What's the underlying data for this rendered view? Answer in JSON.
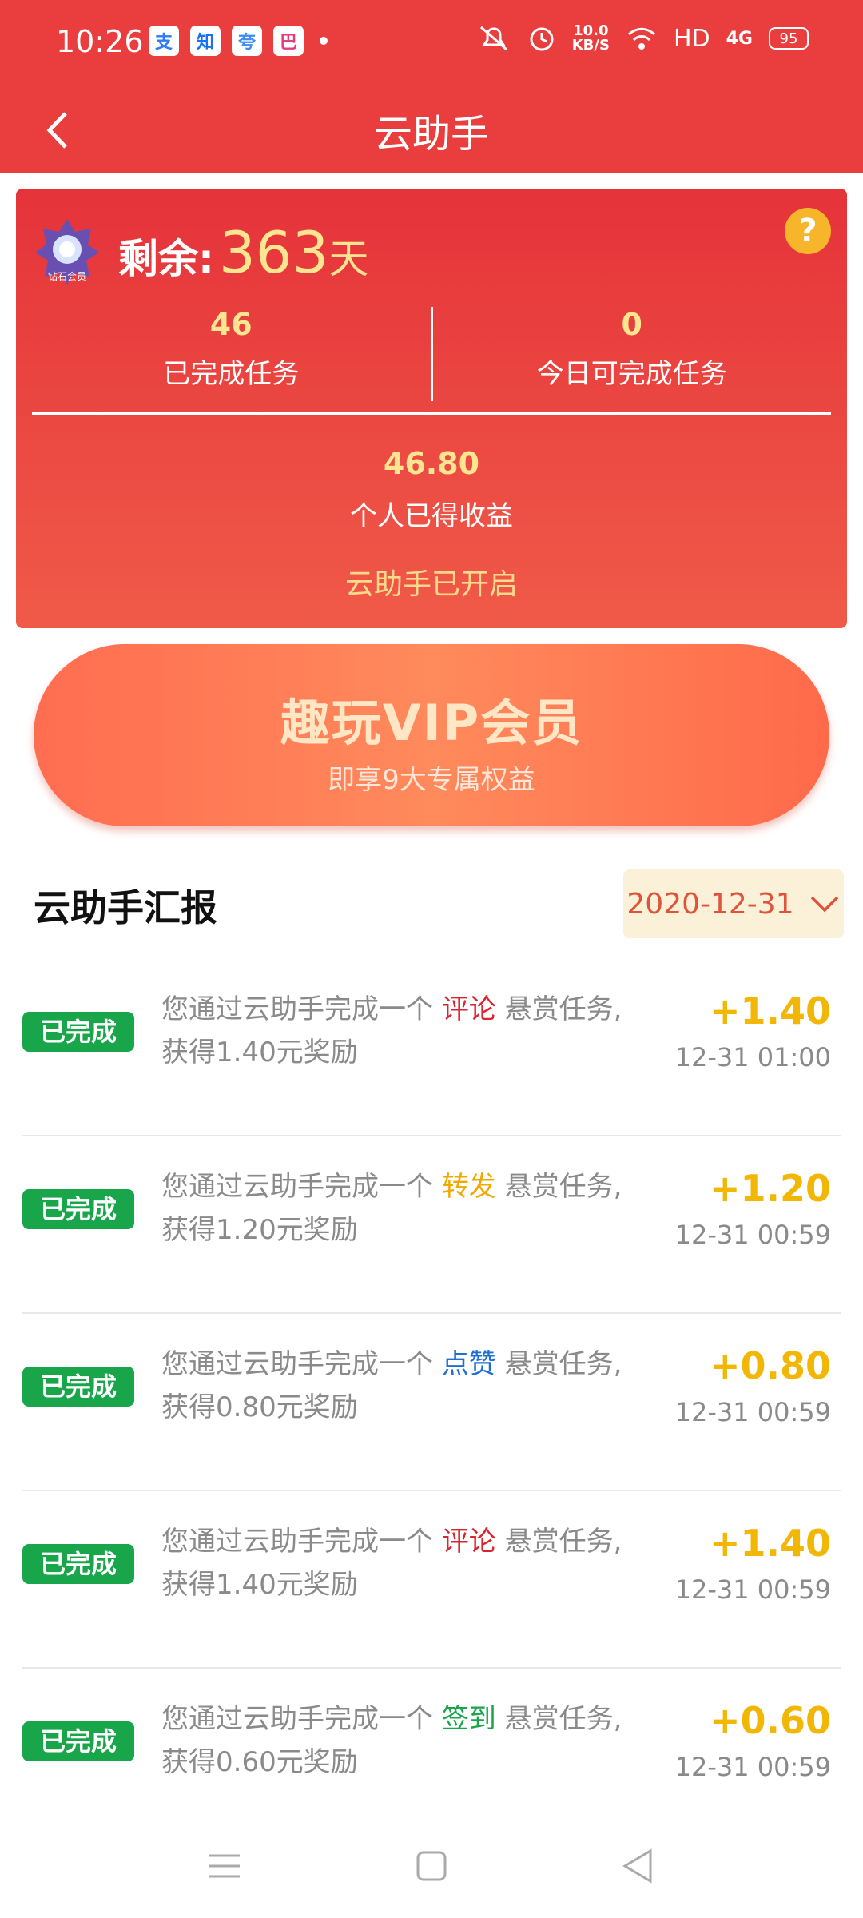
{
  "status": {
    "time": "10:26",
    "apps": [
      "支",
      "知",
      "夸",
      "巴"
    ],
    "net_speed_value": "10.0",
    "net_speed_unit": "KB/S",
    "hd": "HD",
    "signal": "4G",
    "battery": "95"
  },
  "header": {
    "title": "云助手"
  },
  "card": {
    "badge_text": "钻石会员",
    "remain_label": "剩余:",
    "remain_days": "363",
    "remain_unit": "天",
    "stats": [
      {
        "value": "46",
        "label": "已完成任务"
      },
      {
        "value": "0",
        "label": "今日可完成任务"
      }
    ],
    "earnings_value": "46.80",
    "earnings_label": "个人已得收益",
    "state": "云助手已开启"
  },
  "vip": {
    "title": "趣玩VIP会员",
    "subtitle": "即享9大专属权益"
  },
  "report": {
    "title": "云助手汇报",
    "date": "2020-12-31",
    "items": [
      {
        "status": "已完成",
        "prefix": "您通过云助手完成一个",
        "task": "评论",
        "task_color": "#d8252f",
        "suffix": "悬赏任务,",
        "line2": "获得1.40元奖励",
        "amount": "+1.40",
        "time": "12-31 01:00"
      },
      {
        "status": "已完成",
        "prefix": "您通过云助手完成一个",
        "task": "转发",
        "task_color": "#f2a800",
        "suffix": "悬赏任务,",
        "line2": "获得1.20元奖励",
        "amount": "+1.20",
        "time": "12-31 00:59"
      },
      {
        "status": "已完成",
        "prefix": "您通过云助手完成一个",
        "task": "点赞",
        "task_color": "#1f6fd1",
        "suffix": "悬赏任务,",
        "line2": "获得0.80元奖励",
        "amount": "+0.80",
        "time": "12-31 00:59"
      },
      {
        "status": "已完成",
        "prefix": "您通过云助手完成一个",
        "task": "评论",
        "task_color": "#d8252f",
        "suffix": "悬赏任务,",
        "line2": "获得1.40元奖励",
        "amount": "+1.40",
        "time": "12-31 00:59"
      },
      {
        "status": "已完成",
        "prefix": "您通过云助手完成一个",
        "task": "签到",
        "task_color": "#19a54a",
        "suffix": "悬赏任务,",
        "line2": "获得0.60元奖励",
        "amount": "+0.60",
        "time": "12-31 00:59"
      }
    ]
  },
  "colors": {
    "header_bg": "#ea3d3d",
    "accent_gold": "#ffe58f",
    "done_green": "#19a54a",
    "amount_yellow": "#f2b705"
  }
}
